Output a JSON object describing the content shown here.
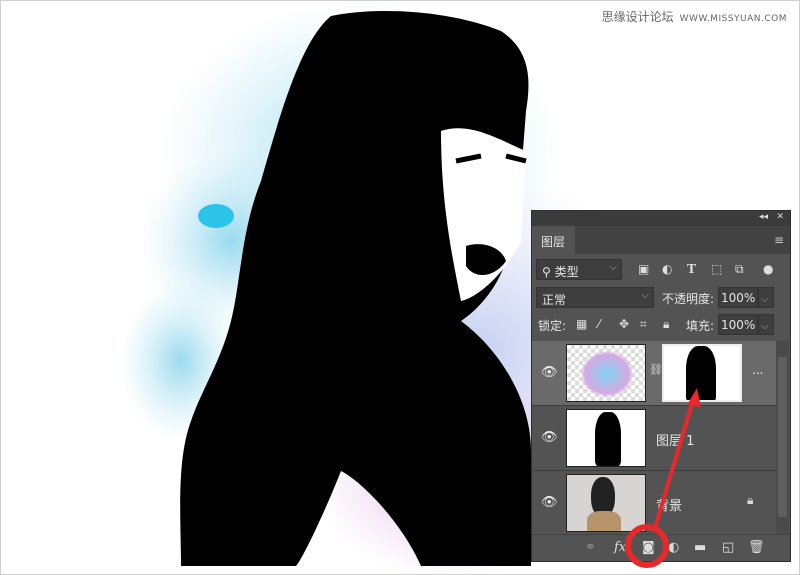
{
  "watermark": {
    "site_name": "思缘设计论坛",
    "url": "WWW.MISSYUAN.COM"
  },
  "panel": {
    "tab": "图层",
    "filter": {
      "label": "类型",
      "icons": [
        "image-filter-icon",
        "adjustment-filter-icon",
        "text-filter-icon",
        "shape-filter-icon",
        "smart-object-filter-icon",
        "filter-toggle-icon"
      ]
    },
    "blend_mode": "正常",
    "opacity_label": "不透明度:",
    "opacity_value": "100%",
    "lock_label": "锁定:",
    "fill_label": "填充:",
    "fill_value": "100%",
    "layers": [
      {
        "name": "",
        "selected": true,
        "has_mask": true,
        "more": "..."
      },
      {
        "name": "图层 1",
        "selected": false
      },
      {
        "name": "背景",
        "selected": false,
        "locked": true
      }
    ],
    "bottom_icons": [
      "link-icon",
      "fx-icon",
      "add-mask-icon",
      "adjustment-icon",
      "group-icon",
      "new-layer-icon",
      "trash-icon"
    ],
    "fx_label": "fx"
  },
  "annotation": {
    "color": "#e8282b"
  }
}
